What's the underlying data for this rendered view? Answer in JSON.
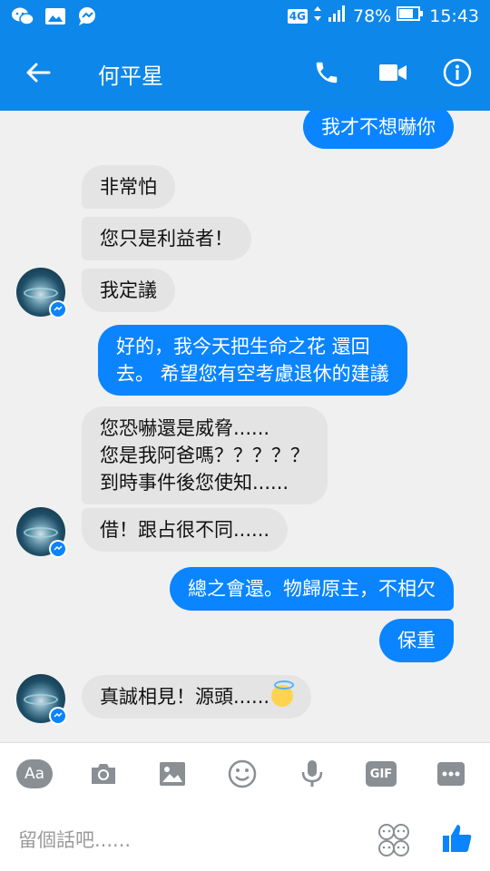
{
  "status_bar": {
    "network": "4G",
    "battery": "78%",
    "time": "15:43"
  },
  "header": {
    "contact_name": "何平星"
  },
  "messages": [
    {
      "side": "out",
      "lines": [
        "我才不想嚇你"
      ]
    },
    {
      "side": "in",
      "lines": [
        "非常怕"
      ]
    },
    {
      "side": "in",
      "lines": [
        "您只是利益者！"
      ]
    },
    {
      "side": "in",
      "lines": [
        "我定議"
      ]
    },
    {
      "side": "out",
      "lines": [
        "好的，我今天把生命之花 還回",
        "去。 希望您有空考慮退休的建議"
      ]
    },
    {
      "side": "in",
      "lines": [
        "您恐嚇還是威脅......",
        "您是我阿爸嗎？？？？？",
        "到時事件後您使知......"
      ]
    },
    {
      "side": "in",
      "lines": [
        "借！跟占很不同......"
      ]
    },
    {
      "side": "out",
      "lines": [
        "總之會還。物歸原主，不相欠"
      ]
    },
    {
      "side": "out",
      "lines": [
        "保重"
      ]
    },
    {
      "side": "in",
      "lines": [
        "真誠相見！源頭......"
      ],
      "emoji": "innocent-smile-emoji"
    }
  ],
  "toolbar": {
    "text_style_label": "Aa",
    "gif_label": "GIF",
    "icons": [
      "text-style-icon",
      "camera-icon",
      "gallery-icon",
      "emoji-icon",
      "microphone-icon",
      "gif-icon",
      "more-icon"
    ]
  },
  "composer": {
    "placeholder": "留個話吧......"
  },
  "colors": {
    "brand_blue": "#0d87ea",
    "outgoing_bubble": "#0a84ff",
    "incoming_bubble": "#e4e4e4",
    "chat_background": "#f0f0f0"
  }
}
